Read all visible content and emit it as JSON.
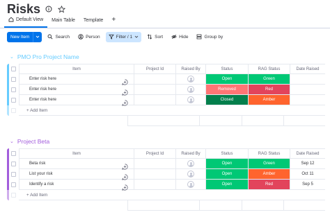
{
  "header": {
    "title": "Risks",
    "views": [
      {
        "label": "Default View",
        "active": true
      },
      {
        "label": "Main Table",
        "active": false
      },
      {
        "label": "Template",
        "active": false
      }
    ],
    "add_view": "+"
  },
  "toolbar": {
    "new_item": "New Item",
    "search": "Search",
    "person": "Person",
    "filter": "Filter / 1",
    "sort": "Sort",
    "hide": "Hide",
    "group_by": "Group by"
  },
  "columns": [
    "Item",
    "Project Id",
    "Raised By",
    "Status",
    "RAG Status",
    "Date Raised"
  ],
  "colors": {
    "accent": "#0073ea",
    "group1": "#66ccff",
    "group2": "#a25ddc",
    "open": "#00c875",
    "removed": "#ff7575",
    "closed": "#037f4c",
    "green": "#00c875",
    "red": "#e2445c",
    "amber": "#ff642e"
  },
  "groups": [
    {
      "title": "PMO Pro Project Name",
      "rows": [
        {
          "item": "Enter risk here",
          "project_id": "",
          "status": "Open",
          "status_color": "#00c875",
          "rag": "Green",
          "rag_color": "#00c875",
          "date": ""
        },
        {
          "item": "Enter risk here",
          "project_id": "",
          "status": "Removed",
          "status_color": "#ff7575",
          "rag": "Red",
          "rag_color": "#e2445c",
          "date": ""
        },
        {
          "item": "Enter risk here",
          "project_id": "",
          "status": "Closed",
          "status_color": "#037f4c",
          "rag": "Amber",
          "rag_color": "#ff642e",
          "date": ""
        }
      ],
      "add_item": "+ Add Item"
    },
    {
      "title": "Project Beta",
      "rows": [
        {
          "item": "Beta risk",
          "project_id": "",
          "status": "Open",
          "status_color": "#00c875",
          "rag": "Green",
          "rag_color": "#00c875",
          "date": "Sep 12"
        },
        {
          "item": "List your risk",
          "project_id": "",
          "status": "Open",
          "status_color": "#00c875",
          "rag": "Amber",
          "rag_color": "#ff642e",
          "date": "Oct 11"
        },
        {
          "item": "Identify a risk",
          "project_id": "",
          "status": "Open",
          "status_color": "#00c875",
          "rag": "Red",
          "rag_color": "#e2445c",
          "date": "Sep 5"
        }
      ],
      "add_item": "+ Add Item"
    }
  ]
}
